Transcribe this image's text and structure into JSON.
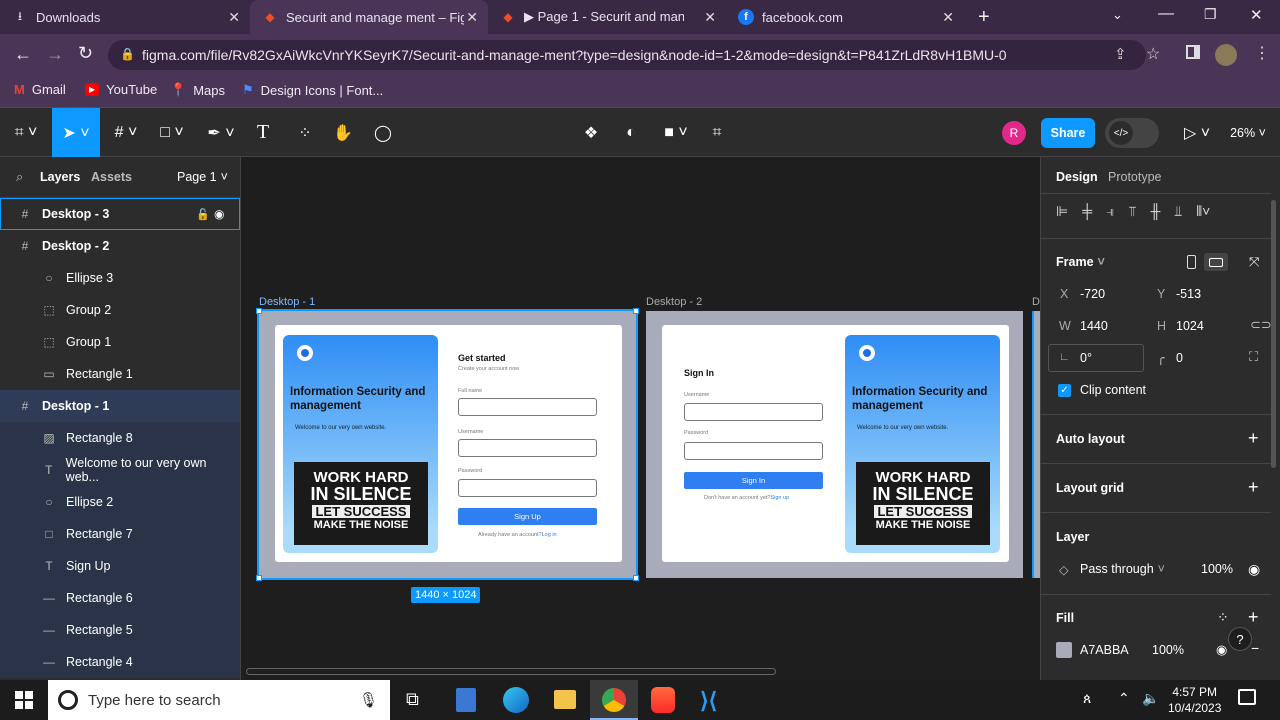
{
  "browser": {
    "tabs": [
      {
        "label": "Downloads",
        "icon": "download-icon"
      },
      {
        "label": "Securit and manage ment – Figm",
        "icon": "figma-icon"
      },
      {
        "label": "▶ Page 1 - Securit and manage",
        "icon": "figma-icon"
      },
      {
        "label": "facebook.com",
        "icon": "facebook-icon"
      }
    ],
    "url": "figma.com/file/Rv82GxAiWkcVnrYKSeyrK7/Securit-and-manage-ment?type=design&node-id=1-2&mode=design&t=P841ZrLdR8vH1BMU-0",
    "bookmarks": [
      "Gmail",
      "YouTube",
      "Maps",
      "Design Icons | Font..."
    ]
  },
  "figma": {
    "share_label": "Share",
    "avatar_letter": "R",
    "zoom": "26%",
    "left_tabs": {
      "layers": "Layers",
      "assets": "Assets",
      "page": "Page 1"
    },
    "layers": [
      {
        "label": "Desktop - 3",
        "glyph": "#",
        "indent": 0,
        "bold": true,
        "state": "hover"
      },
      {
        "label": "Desktop - 2",
        "glyph": "#",
        "indent": 0,
        "bold": true,
        "state": ""
      },
      {
        "label": "Ellipse 3",
        "glyph": "○",
        "indent": 1,
        "bold": false,
        "state": ""
      },
      {
        "label": "Group 2",
        "glyph": "⬚",
        "indent": 1,
        "bold": false,
        "state": ""
      },
      {
        "label": "Group 1",
        "glyph": "⬚",
        "indent": 1,
        "bold": false,
        "state": ""
      },
      {
        "label": "Rectangle 1",
        "glyph": "▭",
        "indent": 1,
        "bold": false,
        "state": ""
      },
      {
        "label": "Desktop - 1",
        "glyph": "#",
        "indent": 0,
        "bold": true,
        "state": "selected"
      },
      {
        "label": "Rectangle 8",
        "glyph": "▨",
        "indent": 1,
        "bold": false,
        "state": "child"
      },
      {
        "label": "Welcome to our very own web...",
        "glyph": "T",
        "indent": 1,
        "bold": false,
        "state": "child"
      },
      {
        "label": "Ellipse 2",
        "glyph": "○",
        "indent": 1,
        "bold": false,
        "state": "child"
      },
      {
        "label": "Rectangle 7",
        "glyph": "□",
        "indent": 1,
        "bold": false,
        "state": "child"
      },
      {
        "label": "Sign Up",
        "glyph": "T",
        "indent": 1,
        "bold": false,
        "state": "child"
      },
      {
        "label": "Rectangle 6",
        "glyph": "—",
        "indent": 1,
        "bold": false,
        "state": "child"
      },
      {
        "label": "Rectangle 5",
        "glyph": "—",
        "indent": 1,
        "bold": false,
        "state": "child"
      },
      {
        "label": "Rectangle 4",
        "glyph": "—",
        "indent": 1,
        "bold": false,
        "state": "child"
      }
    ],
    "canvas": {
      "frame1_label": "Desktop - 1",
      "frame2_label": "Desktop - 2",
      "frame3_label": "D",
      "size_badge": "1440 × 1024",
      "hero_title": "Information Security and management",
      "hero_sub": "Welcome to our very own website.",
      "poster_lines": [
        "WORK HARD",
        "IN SILENCE",
        "LET SUCCESS",
        "MAKE THE NOISE"
      ],
      "signup": {
        "title": "Get started",
        "subtitle": "Create your account now",
        "f1": "Full name",
        "f2": "Username",
        "f3": "Password",
        "button": "Sign Up",
        "footer": "Already have an account?",
        "link": "Log in"
      },
      "signin": {
        "title": "Sign In",
        "f1": "Username",
        "f2": "Password",
        "button": "Sign In",
        "footer": "Don't have an account yet?",
        "link": "Sign up"
      }
    },
    "right": {
      "tabs": {
        "design": "Design",
        "prototype": "Prototype"
      },
      "frame_label": "Frame",
      "x_label": "X",
      "x": "-720",
      "y_label": "Y",
      "y": "-513",
      "w_label": "W",
      "w": "1440",
      "h_label": "H",
      "h": "1024",
      "rotation": "0°",
      "radius": "0",
      "clip_content": "Clip content",
      "auto_layout": "Auto layout",
      "layout_grid": "Layout grid",
      "layer": "Layer",
      "blend": "Pass through",
      "opacity": "100%",
      "fill": "Fill",
      "fill_hex": "A7ABBA",
      "fill_opacity": "100%"
    }
  },
  "taskbar": {
    "search_placeholder": "Type here to search",
    "time": "4:57 PM",
    "date": "10/4/2023"
  },
  "colors": {
    "accent": "#0d99ff",
    "frame_bg": "#a7abba",
    "button": "#2f7ef2"
  }
}
